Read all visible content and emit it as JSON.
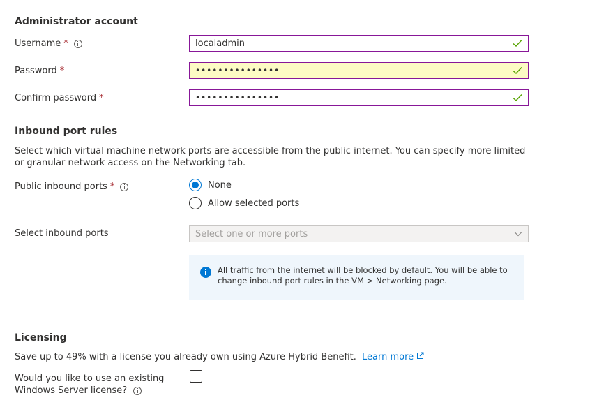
{
  "admin": {
    "heading": "Administrator account",
    "username_label": "Username",
    "username_value": "localadmin",
    "password_label": "Password",
    "password_value": "•••••••••••••••",
    "confirm_label": "Confirm password",
    "confirm_value": "•••••••••••••••",
    "required_mark": "*"
  },
  "inbound": {
    "heading": "Inbound port rules",
    "description": "Select which virtual machine network ports are accessible from the public internet. You can specify more limited or granular network access on the Networking tab.",
    "public_ports_label": "Public inbound ports",
    "options": [
      "None",
      "Allow selected ports"
    ],
    "selected_option": "None",
    "select_ports_label": "Select inbound ports",
    "select_ports_placeholder": "Select one or more ports",
    "info_text": "All traffic from the internet will be blocked by default. You will be able to change inbound port rules in the VM > Networking page."
  },
  "licensing": {
    "heading": "Licensing",
    "description": "Save up to 49% with a license you already own using Azure Hybrid Benefit.",
    "learn_more": "Learn more",
    "existing_license_label": "Would you like to use an existing Windows Server license?",
    "existing_license_checked": false
  },
  "colors": {
    "accent": "#0078d4",
    "field_border": "#881798",
    "autofill_bg": "#fdfbc4",
    "valid_check": "#57a300",
    "required": "#a4262c",
    "info_bg": "#eff6fc"
  },
  "icons": [
    "info-icon",
    "checkmark-icon",
    "chevron-down-icon",
    "external-link-icon",
    "info-circle-icon"
  ]
}
